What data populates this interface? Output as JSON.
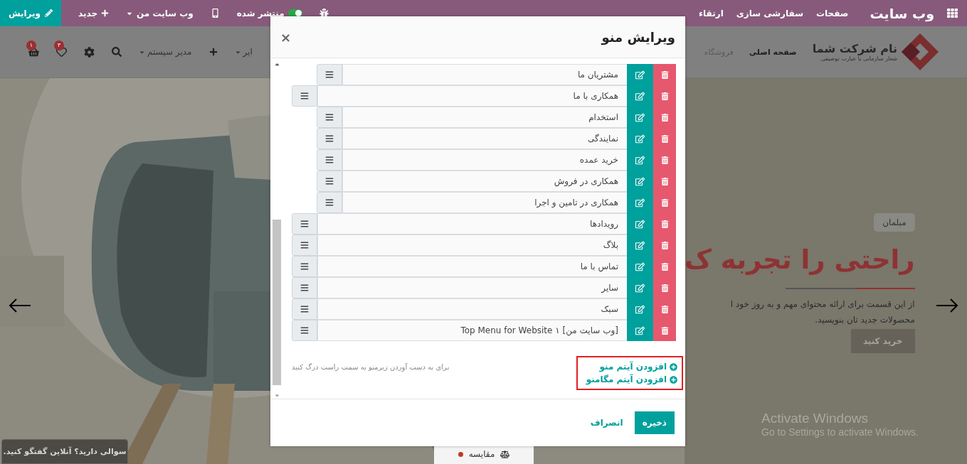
{
  "topbar": {
    "app_title": "وب سایت",
    "menu": [
      "صفحات",
      "سفارشی سازی",
      "ارتقاء"
    ],
    "publish": {
      "label": "منتشر شده",
      "on": true
    },
    "website_dropdown": "وب سایت من",
    "new_button": "جدید",
    "edit_button": "ویرایش"
  },
  "site_header": {
    "logo": {
      "name": "نام شرکت شما",
      "slogan": "شعار سازمانی یا عبارت توصیفی"
    },
    "nav": [
      {
        "label": "صفحه اصلی",
        "selected": true
      },
      {
        "label": "فروشگاه",
        "selected": false
      }
    ],
    "nav_cut": "ایر",
    "user_menu": "مدیر سیستم",
    "wishlist_badge": "۳",
    "cart_badge": "۱"
  },
  "hero": {
    "tag": "مبلمان",
    "heading": "راحتی را تجربه ک",
    "paragraph_lines": [
      "از این قسمت برای ارائه محتوای مهم و به روز خود ا",
      "محصولات جدید تان بنویسید."
    ],
    "button": "خرید کنید"
  },
  "compare_button": "مقایسه",
  "chat_button": "سوالی دارید؟ آنلاین گفتگو کنید.",
  "os_notice": {
    "title": "Activate Windows",
    "text": "Go to Settings to activate Windows."
  },
  "dialog": {
    "title": "ویرایش منو",
    "close": "×",
    "menu_items": [
      {
        "children": [
          {
            "label": "مشتریان ما"
          }
        ]
      },
      {
        "label": "همکاری با ما",
        "children": [
          {
            "label": "استخدام"
          },
          {
            "label": "نمایندگی"
          },
          {
            "label": "خرید عمده"
          },
          {
            "label": "همکاری در فروش"
          },
          {
            "label": "همکاری در تامین و اجرا"
          }
        ]
      },
      {
        "label": "رویدادها"
      },
      {
        "label": "بلاگ"
      },
      {
        "label": "تماس با ما"
      },
      {
        "label": "سایر"
      },
      {
        "label": "سبک"
      },
      {
        "label": "[وب سایت من] Top Menu for Website ۱"
      }
    ],
    "add_links": [
      "افزودن آیتم منو",
      "افزودن آیتم مگامنو"
    ],
    "hint": "برای به دست آوردن زیرمنو به سمت راست درگ کنید",
    "save": "ذخیره",
    "cancel": "انصراف"
  }
}
